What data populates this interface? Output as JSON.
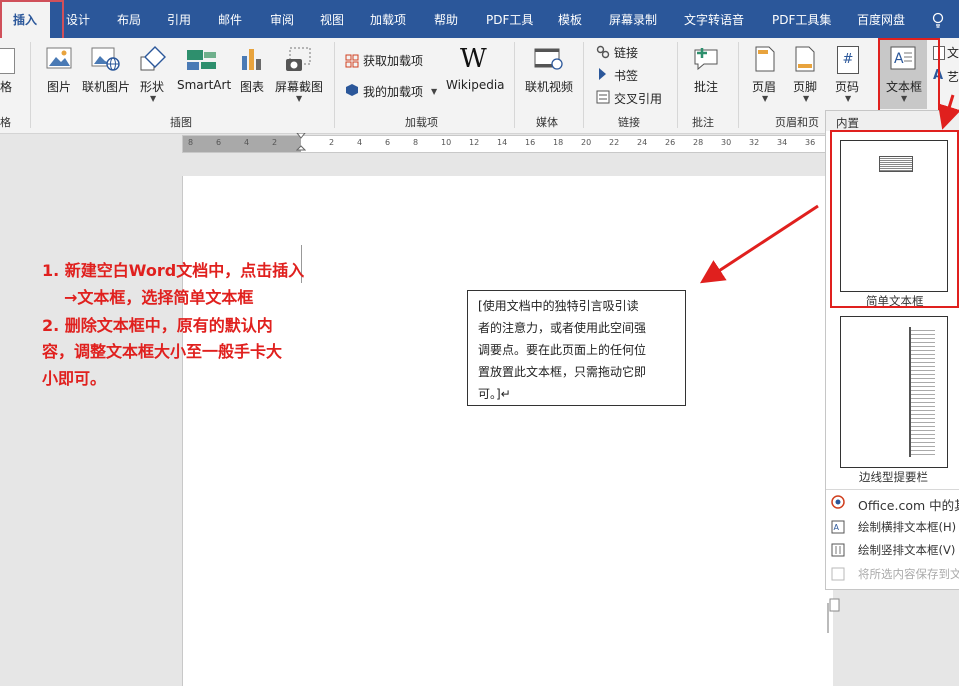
{
  "tabs": [
    "插入",
    "设计",
    "布局",
    "引用",
    "邮件",
    "审阅",
    "视图",
    "加载项",
    "帮助",
    "PDF工具",
    "模板",
    "屏幕录制",
    "文字转语音",
    "PDF工具集",
    "百度网盘"
  ],
  "ribbon": {
    "cut_table_label": "格",
    "cut_table_group": "格",
    "picture": "图片",
    "online_picture": "联机图片",
    "shapes": "形状",
    "smartart": "SmartArt",
    "chart": "图表",
    "screenshot": "屏幕截图",
    "illustrations_group": "插图",
    "get_addins": "获取加载项",
    "my_addins": "我的加载项",
    "wikipedia_logo": "W",
    "wikipedia": "Wikipedia",
    "addins_group": "加载项",
    "online_video": "联机视频",
    "media_group": "媒体",
    "link": "链接",
    "bookmark": "书签",
    "cross_ref": "交叉引用",
    "links_group": "链接",
    "comment": "批注",
    "comments_group": "批注",
    "header": "页眉",
    "footer": "页脚",
    "page_number": "页码",
    "page_number_icon": "#",
    "header_footer_group": "页眉和页",
    "textbox": "文本框",
    "cut_right1": "文",
    "cut_right2": "艺"
  },
  "ruler": [
    "8",
    "6",
    "4",
    "2",
    "2",
    "4",
    "6",
    "8",
    "10",
    "12",
    "14",
    "16",
    "18",
    "20",
    "22",
    "24",
    "26",
    "28",
    "30",
    "32",
    "34",
    "36"
  ],
  "instructions": {
    "line1": "1. 新建空白Word文档中，点击插入",
    "line2": "→文本框，选择简单文本框",
    "line3": "2. 删除文本框中，原有的默认内",
    "line4": "容，调整文本框大小至一般手卡大",
    "line5": "小即可。"
  },
  "textbox_lines": [
    "[使用文档中的独特引言吸引读",
    "者的注意力，或者使用此空间强",
    "调要点。要在此页面上的任何位",
    "置放置此文本框，只需拖动它即",
    "可。]↵"
  ],
  "gallery": {
    "header": "内置",
    "simple_textbox": "简单文本框",
    "sidebar_textbox": "边线型提要栏",
    "office_more": "Office.com 中的其",
    "draw_horizontal": "绘制横排文本框(H)",
    "draw_vertical": "绘制竖排文本框(V)",
    "save_selection": "将所选内容保存到文"
  },
  "colors": {
    "tab_bar": "#2b579a",
    "annotation_red": "#e0201e",
    "ribbon_bg": "#f3f3f3"
  }
}
